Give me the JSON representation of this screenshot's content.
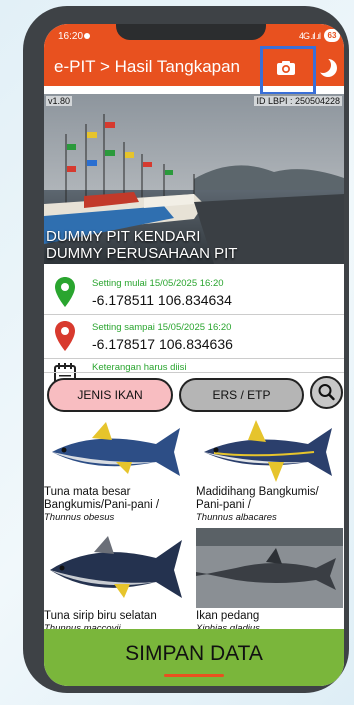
{
  "status": {
    "time": "16:20",
    "signal": "4G .ıl .ıl",
    "battery": "63"
  },
  "appbar": {
    "title": "e-PIT > Hasil Tangkapan"
  },
  "photo": {
    "version": "v1.80",
    "lbpi_id": "ID LBPI : 250504228",
    "location_line1": "DUMMY PIT KENDARI",
    "location_line2": "DUMMY PERUSAHAAN PIT"
  },
  "start": {
    "label": "Setting mulai 15/05/2025 16:20",
    "coords": "-6.178511 106.834634"
  },
  "end": {
    "label": "Setting sampai 15/05/2025 16:20",
    "coords": "-6.178517 106.834636"
  },
  "note": {
    "label": "Keterangan harus diisi"
  },
  "tabs": {
    "fish": "JENIS IKAN",
    "ers": "ERS / ETP"
  },
  "fish": [
    {
      "name": "Tuna mata besar Bangkumis/Pani-pani /",
      "sci": "Thunnus obesus"
    },
    {
      "name": "Madidihang Bangkumis/ Pani-pani /",
      "sci": "Thunnus albacares"
    },
    {
      "name": "Tuna sirip biru selatan",
      "sci": "Thunnus maccoyii"
    },
    {
      "name": "Ikan pedang",
      "sci": "Xiphias gladius"
    }
  ],
  "save_label": "SIMPAN DATA",
  "colors": {
    "primary": "#e8511f",
    "accent_green": "#2aa52f",
    "save_bg": "#7ab63b",
    "highlight": "#3a6fd8"
  }
}
